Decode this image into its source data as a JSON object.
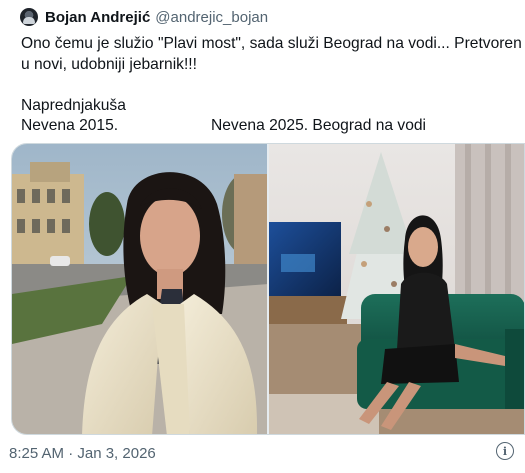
{
  "tweet": {
    "author_name": "Bojan Andrejić",
    "author_handle": "@andrejic_bojan",
    "avatar_icon": "user-avatar",
    "text_line1": "Ono čemu je služio \"Plavi most\", sada služi Beograd na vodi... Pretvoren je",
    "text_line2": "u novi, udobniji jebarnik!!!",
    "text_line3": "Naprednjakuša",
    "caption_left": "Nevena 2015.",
    "caption_right": "Nevena 2025. Beograd na vodi",
    "timestamp": "8:25 AM · Jan 3, 2026",
    "info_icon": "info-icon",
    "info_glyph": "i"
  },
  "media": {
    "left_photo": "woman in white coat on city street",
    "right_photo": "woman in black dress on green sofa beside christmas tree"
  }
}
